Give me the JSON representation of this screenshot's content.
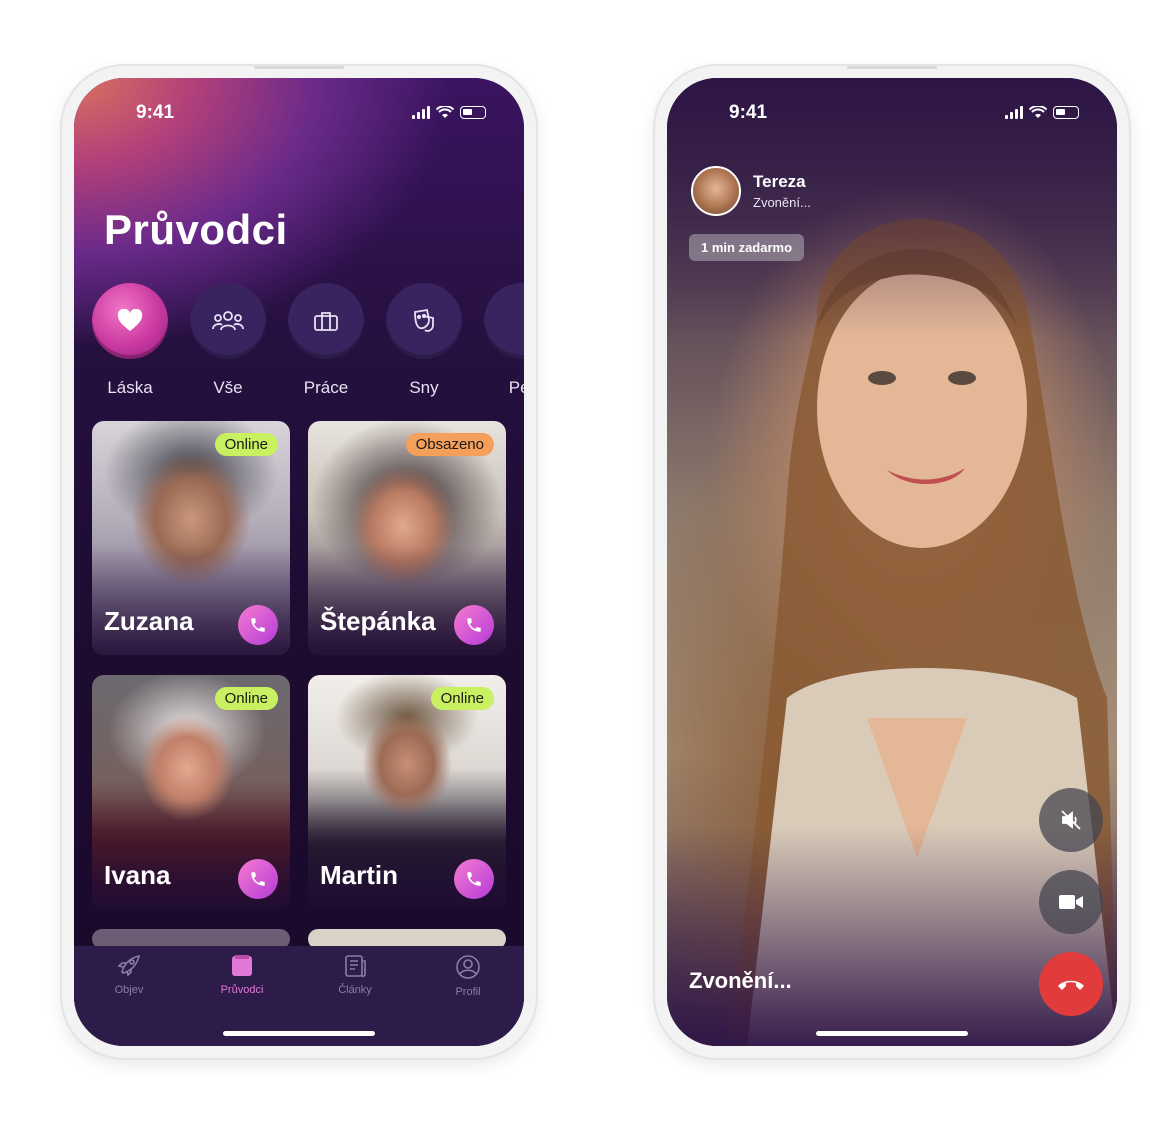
{
  "left_phone": {
    "status_time": "9:41",
    "page_title": "Průvodci",
    "categories": [
      {
        "label": "Láska",
        "icon": "heart-icon",
        "active": true
      },
      {
        "label": "Vše",
        "icon": "group-icon",
        "active": false
      },
      {
        "label": "Práce",
        "icon": "briefcase-icon",
        "active": false
      },
      {
        "label": "Sny",
        "icon": "mask-icon",
        "active": false
      },
      {
        "label": "Per",
        "icon": "partial-category-icon",
        "active": false
      }
    ],
    "guides": [
      {
        "name": "Zuzana",
        "status": "Online"
      },
      {
        "name": "Štepánka",
        "status": "Obsazeno"
      },
      {
        "name": "Ivana",
        "status": "Online"
      },
      {
        "name": "Martin",
        "status": "Online"
      }
    ],
    "tabs": [
      {
        "label": "Objev",
        "icon": "rocket-icon"
      },
      {
        "label": "Průvodci",
        "icon": "guides-icon"
      },
      {
        "label": "Články",
        "icon": "articles-icon"
      },
      {
        "label": "Profil",
        "icon": "profile-icon"
      }
    ]
  },
  "right_phone": {
    "status_time": "9:41",
    "caller_name": "Tereza",
    "caller_status": "Zvonění...",
    "free_pill": "1 min zadarmo",
    "ringing_label": "Zvonění...",
    "controls": [
      "mute-icon",
      "video-camera-icon",
      "end-call-icon"
    ]
  },
  "colors": {
    "online_badge": "#c9f060",
    "busy_badge": "#f4a05a",
    "accent_pink": "#e078d6",
    "end_call": "#e23b3b"
  }
}
